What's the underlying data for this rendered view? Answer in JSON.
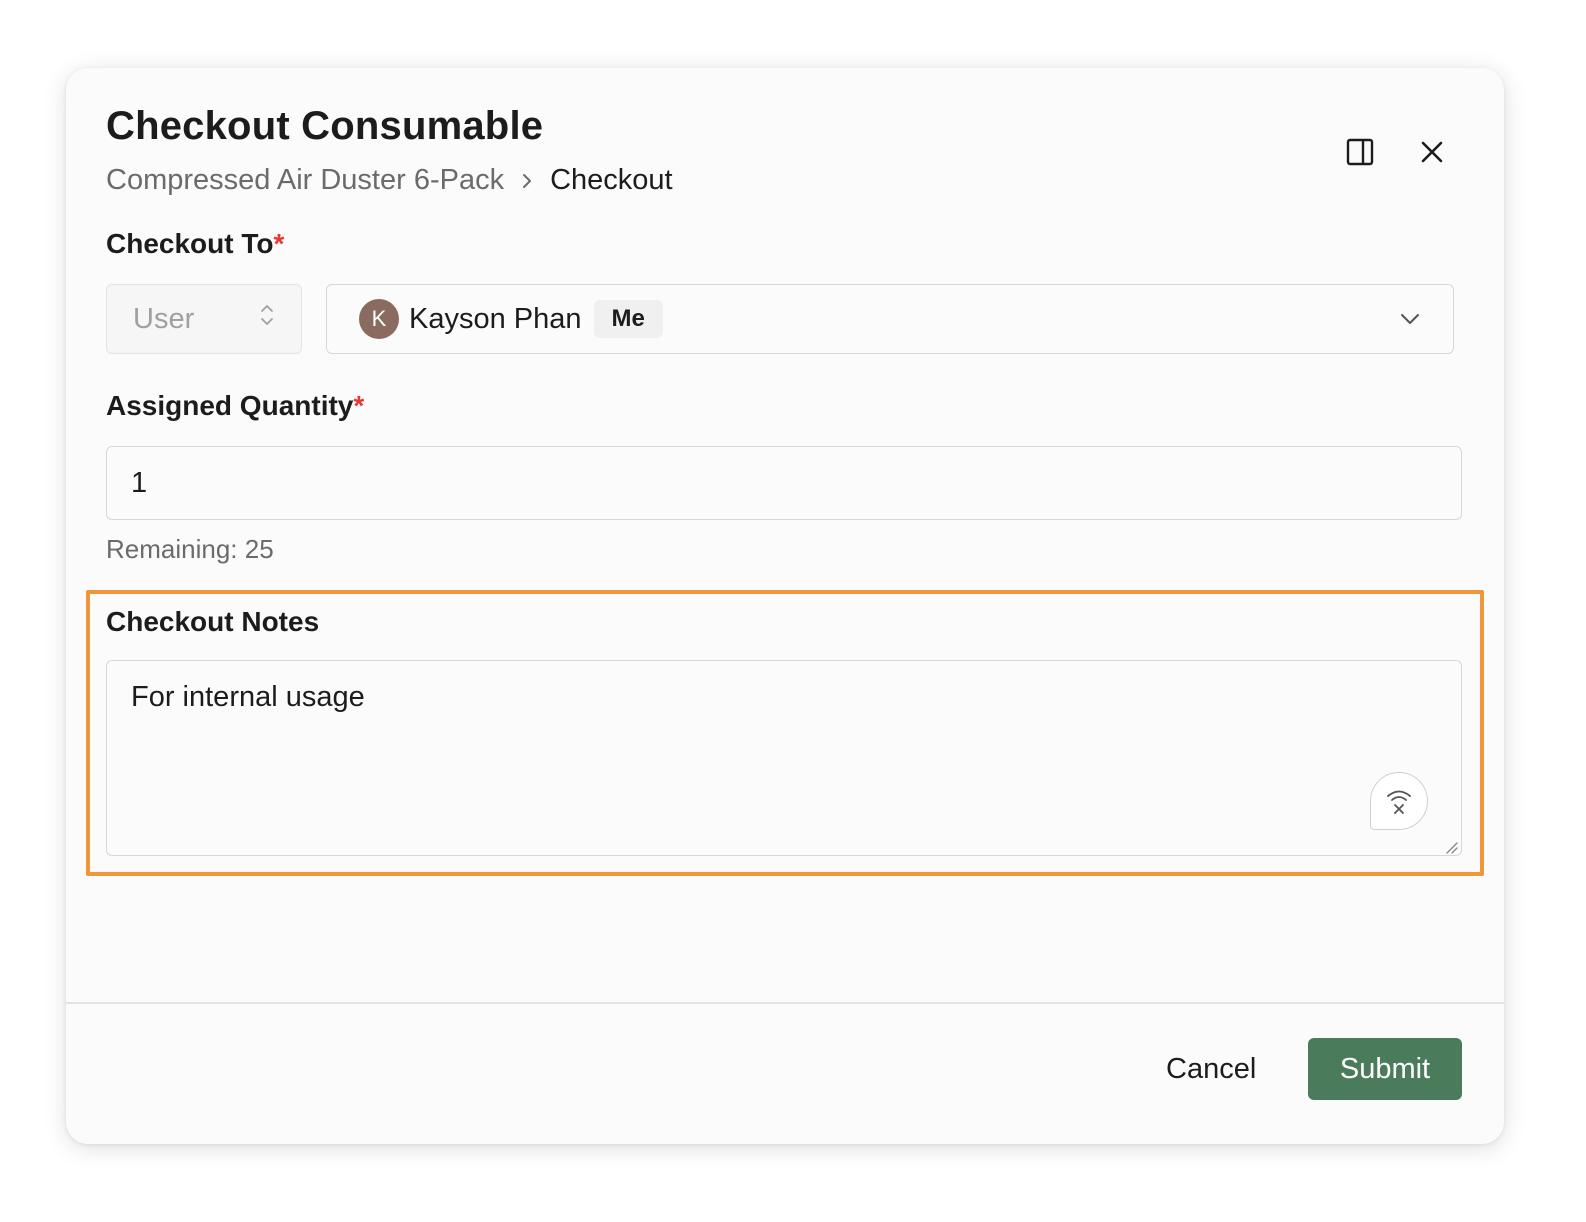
{
  "dialog": {
    "title": "Checkout Consumable",
    "breadcrumb": {
      "parent": "Compressed Air Duster 6-Pack",
      "current": "Checkout"
    },
    "icons": {
      "side_panel": "side-panel-icon",
      "close": "close-icon"
    }
  },
  "form": {
    "checkout_to": {
      "label": "Checkout To",
      "required_marker": "*",
      "type_select": {
        "value": "User",
        "icon": "up-down-chevron-icon"
      },
      "user_select": {
        "avatar_initial": "K",
        "name": "Kayson Phan",
        "badge": "Me",
        "icon": "chevron-down-icon"
      }
    },
    "assigned_quantity": {
      "label": "Assigned Quantity",
      "required_marker": "*",
      "value": "1",
      "helper": "Remaining: 25"
    },
    "checkout_notes": {
      "label": "Checkout Notes",
      "value": "For internal usage",
      "voice_icon": "voice-input-off-icon"
    }
  },
  "footer": {
    "cancel_label": "Cancel",
    "submit_label": "Submit"
  },
  "colors": {
    "accent": "#4a7c5c",
    "required": "#e53935",
    "highlight": "#f0963a"
  }
}
